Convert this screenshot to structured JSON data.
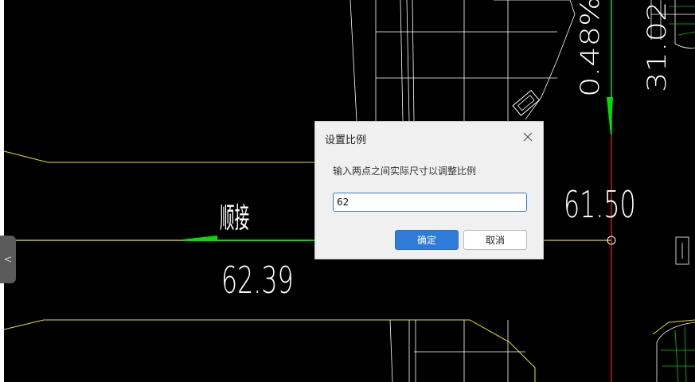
{
  "drawing": {
    "labels": {
      "shunjie": "顺接",
      "elevation_left": "62.39",
      "elevation_right": "61.50",
      "slope": "0.48%",
      "elevation_top_right": "31.02"
    }
  },
  "dialog": {
    "title": "设置比例",
    "prompt": "输入两点之间实际尺寸以调整比例",
    "input_value": "62",
    "ok_label": "确定",
    "cancel_label": "取消"
  },
  "left_handle": {
    "glyph": "<"
  },
  "colors": {
    "canvas_bg": "#000000",
    "line_white": "#ffffff",
    "line_yellow": "#e6e600",
    "line_green": "#00e000",
    "line_red": "#ff2020",
    "accent_blue": "#2f7bd8"
  }
}
